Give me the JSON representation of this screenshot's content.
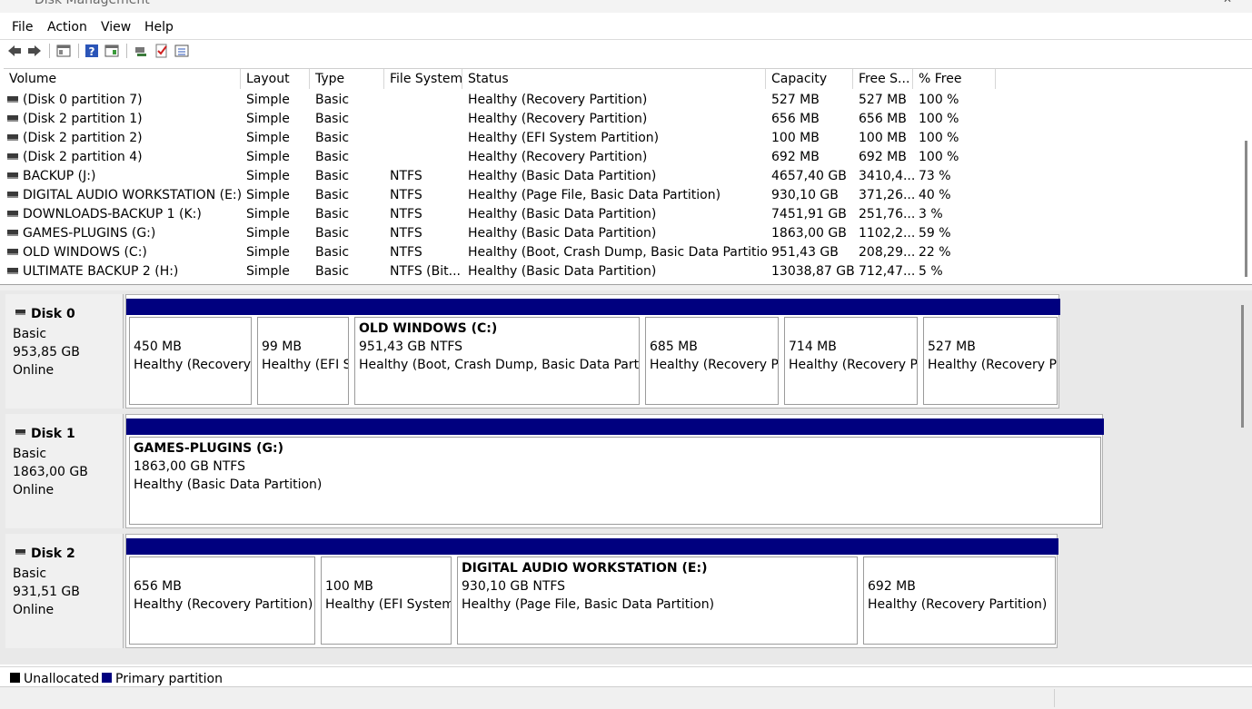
{
  "window": {
    "title": "Disk Management",
    "minimize_glyph": "—",
    "close_glyph": "✕"
  },
  "menu": [
    "File",
    "Action",
    "View",
    "Help"
  ],
  "toolbar": {
    "icons": [
      "back-arrow-icon",
      "forward-arrow-icon",
      "console-tree-icon",
      "help-icon",
      "properties-icon",
      "connect-icon",
      "check-icon",
      "list-view-icon"
    ]
  },
  "volume_list": {
    "columns": [
      "Volume",
      "Layout",
      "Type",
      "File System",
      "Status",
      "Capacity",
      "Free S...",
      "% Free"
    ],
    "rows": [
      [
        "(Disk 0 partition 7)",
        "Simple",
        "Basic",
        "",
        "Healthy (Recovery Partition)",
        "527 MB",
        "527 MB",
        "100 %"
      ],
      [
        "(Disk 2 partition 1)",
        "Simple",
        "Basic",
        "",
        "Healthy (Recovery Partition)",
        "656 MB",
        "656 MB",
        "100 %"
      ],
      [
        "(Disk 2 partition 2)",
        "Simple",
        "Basic",
        "",
        "Healthy (EFI System Partition)",
        "100 MB",
        "100 MB",
        "100 %"
      ],
      [
        "(Disk 2 partition 4)",
        "Simple",
        "Basic",
        "",
        "Healthy (Recovery Partition)",
        "692 MB",
        "692 MB",
        "100 %"
      ],
      [
        "BACKUP (J:)",
        "Simple",
        "Basic",
        "NTFS",
        "Healthy (Basic Data Partition)",
        "4657,40 GB",
        "3410,4...",
        "73 %"
      ],
      [
        "DIGITAL AUDIO WORKSTATION (E:)",
        "Simple",
        "Basic",
        "NTFS",
        "Healthy (Page File, Basic Data Partition)",
        "930,10 GB",
        "371,26...",
        "40 %"
      ],
      [
        "DOWNLOADS-BACKUP 1 (K:)",
        "Simple",
        "Basic",
        "NTFS",
        "Healthy (Basic Data Partition)",
        "7451,91 GB",
        "251,76...",
        "3 %"
      ],
      [
        "GAMES-PLUGINS (G:)",
        "Simple",
        "Basic",
        "NTFS",
        "Healthy (Basic Data Partition)",
        "1863,00 GB",
        "1102,2...",
        "59 %"
      ],
      [
        "OLD WINDOWS (C:)",
        "Simple",
        "Basic",
        "NTFS",
        "Healthy (Boot, Crash Dump, Basic Data Partition)",
        "951,43 GB",
        "208,29...",
        "22 %"
      ],
      [
        "ULTIMATE BACKUP 2 (H:)",
        "Simple",
        "Basic",
        "NTFS (Bit...",
        "Healthy (Basic Data Partition)",
        "13038,87 GB",
        "712,47...",
        "5 %"
      ]
    ]
  },
  "disks": [
    {
      "name": "Disk 0",
      "type": "Basic",
      "size": "953,85 GB",
      "state": "Online",
      "partitions": [
        {
          "title": "",
          "l1": "450 MB",
          "l2": "Healthy (Recovery P"
        },
        {
          "title": "",
          "l1": "99 MB",
          "l2": "Healthy (EFI Sy"
        },
        {
          "title": "OLD WINDOWS  (C:)",
          "l1": "951,43 GB NTFS",
          "l2": "Healthy (Boot, Crash Dump, Basic Data Partition)"
        },
        {
          "title": "",
          "l1": "685 MB",
          "l2": "Healthy (Recovery Pa"
        },
        {
          "title": "",
          "l1": "714 MB",
          "l2": "Healthy (Recovery Pa"
        },
        {
          "title": "",
          "l1": "527 MB",
          "l2": "Healthy (Recovery P"
        }
      ]
    },
    {
      "name": "Disk 1",
      "type": "Basic",
      "size": "1863,00 GB",
      "state": "Online",
      "partitions": [
        {
          "title": "GAMES-PLUGINS  (G:)",
          "l1": "1863,00 GB NTFS",
          "l2": "Healthy (Basic Data Partition)"
        }
      ]
    },
    {
      "name": "Disk 2",
      "type": "Basic",
      "size": "931,51 GB",
      "state": "Online",
      "partitions": [
        {
          "title": "",
          "l1": "656 MB",
          "l2": "Healthy (Recovery Partition)"
        },
        {
          "title": "",
          "l1": "100 MB",
          "l2": "Healthy (EFI System"
        },
        {
          "title": "DIGITAL AUDIO WORKSTATION  (E:)",
          "l1": "930,10 GB NTFS",
          "l2": "Healthy (Page File, Basic Data Partition)"
        },
        {
          "title": "",
          "l1": "692 MB",
          "l2": "Healthy (Recovery Partition)"
        }
      ]
    }
  ],
  "legend": {
    "unallocated": "Unallocated",
    "primary": "Primary partition",
    "unallocated_color": "#000000",
    "primary_color": "#00007f"
  }
}
